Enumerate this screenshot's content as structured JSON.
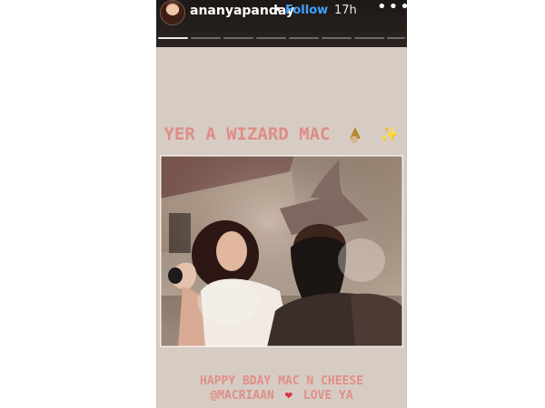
{
  "header": {
    "username": "ananyapanday",
    "separator": "•",
    "follow_label": "Follow",
    "time": "17h",
    "more_icon": "more-dots-icon"
  },
  "story": {
    "title": "YER A WIZARD MAC",
    "line1": "HAPPY BDAY MAC N CHEESE",
    "mention": "@MACRIAAN",
    "line2_suffix": "LOVE YA"
  },
  "icons": {
    "avatar": "profile-avatar",
    "wizard": "wizard-icon",
    "sparkles": "sparkles-icon",
    "heart": "heart-icon"
  },
  "colors": {
    "header_bg": "#1d1816",
    "follow": "#3ea2ff",
    "caption": "#df8d87",
    "background": "#d7ccc3",
    "heart": "#d82f3c"
  }
}
